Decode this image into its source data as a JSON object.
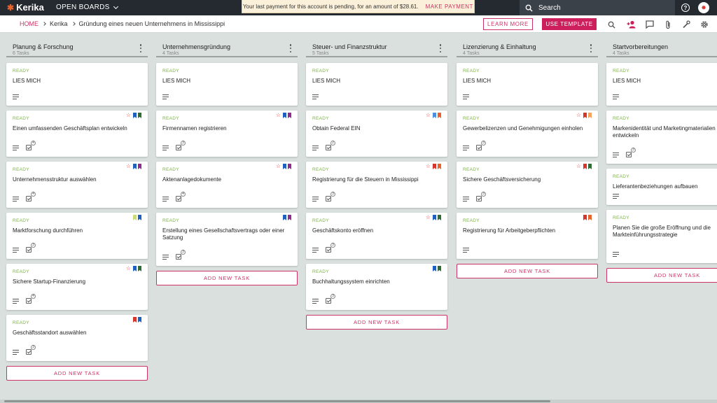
{
  "app": {
    "logo": "Kerika",
    "open_boards": "OPEN BOARDS",
    "payment_message": "Your last payment for this account is pending, for an amount of $28.61.",
    "make_payment": "MAKE PAYMENT",
    "search_placeholder": "Search"
  },
  "breadcrumb": {
    "home": "HOME",
    "org": "Kerika",
    "board": "Gründung eines neuen Unternehmens in Mississippi"
  },
  "toolbar": {
    "learn_more": "LEARN MORE",
    "use_template": "USE TEMPLATE"
  },
  "colors": {
    "accent": "#cc3366",
    "ready": "#7ab342",
    "red": "#d9342b",
    "blue": "#1f5fbf",
    "green": "#2e6b35",
    "purple": "#8e2b8f",
    "orange": "#e8622c",
    "light_blue": "#4a90e2",
    "yellow_green": "#c7dc7a",
    "light_orange": "#f5a25d"
  },
  "add_task_label": "ADD NEW TASK",
  "columns": [
    {
      "title": "Planung & Forschung",
      "count": "6 Tasks",
      "cards": [
        {
          "status": "READY",
          "title": "LIES MICH",
          "checks": null,
          "flags": [],
          "star": false
        },
        {
          "status": "READY",
          "title": "Einen umfassenden Geschäftsplan entwickeln",
          "checks": "4",
          "flags": [
            "blue",
            "green"
          ],
          "star": true
        },
        {
          "status": "READY",
          "title": "Unternehmensstruktur auswählen",
          "checks": "4",
          "flags": [
            "blue",
            "purple"
          ],
          "star": true
        },
        {
          "status": "READY",
          "title": "Marktforschung durchführen",
          "checks": "3",
          "flags": [
            "yellow_green",
            "blue"
          ],
          "star": false
        },
        {
          "status": "READY",
          "title": "Sichere Startup-Finanzierung",
          "checks": "4",
          "flags": [
            "blue",
            "green"
          ],
          "star": true
        },
        {
          "status": "READY",
          "title": "Geschäftsstandort auswählen",
          "checks": "3",
          "flags": [
            "red",
            "blue"
          ],
          "star": false
        }
      ]
    },
    {
      "title": "Unternehmensgründung",
      "count": "4 Tasks",
      "cards": [
        {
          "status": "READY",
          "title": "LIES MICH",
          "checks": null,
          "flags": [],
          "star": false
        },
        {
          "status": "READY",
          "title": "Firmennamen registrieren",
          "checks": "3",
          "flags": [
            "blue",
            "purple"
          ],
          "star": true
        },
        {
          "status": "READY",
          "title": "Aktenanlagedokumente",
          "checks": "4",
          "flags": [
            "blue",
            "purple"
          ],
          "star": true
        },
        {
          "status": "READY",
          "title": "Erstellung eines Gesellschaftsvertrags oder einer Satzung",
          "checks": "3",
          "flags": [
            "blue",
            "purple"
          ],
          "star": false
        }
      ]
    },
    {
      "title": "Steuer- und Finanzstruktur",
      "count": "5 Tasks",
      "cards": [
        {
          "status": "READY",
          "title": "LIES MICH",
          "checks": null,
          "flags": [],
          "star": false
        },
        {
          "status": "READY",
          "title": "Obtain Federal EIN",
          "checks": "2",
          "flags": [
            "light_blue",
            "orange"
          ],
          "star": true
        },
        {
          "status": "READY",
          "title": "Registrierung für die Steuern in Mississippi",
          "checks": "3",
          "flags": [
            "red",
            "orange"
          ],
          "star": true
        },
        {
          "status": "READY",
          "title": "Geschäftskonto eröffnen",
          "checks": "3",
          "flags": [
            "blue",
            "green"
          ],
          "star": true
        },
        {
          "status": "READY",
          "title": "Buchhaltungssystem einrichten",
          "checks": "3",
          "flags": [
            "blue",
            "green"
          ],
          "star": false
        }
      ]
    },
    {
      "title": "Lizenzierung & Einhaltung",
      "count": "4 Tasks",
      "cards": [
        {
          "status": "READY",
          "title": "LIES MICH",
          "checks": null,
          "flags": [],
          "star": false
        },
        {
          "status": "READY",
          "title": "Gewerbelizenzen und Genehmigungen einholen",
          "checks": "3",
          "flags": [
            "red",
            "light_orange"
          ],
          "star": true
        },
        {
          "status": "READY",
          "title": "Sichere Geschäftsversicherung",
          "checks": "3",
          "flags": [
            "red",
            "green"
          ],
          "star": true
        },
        {
          "status": "READY",
          "title": "Registrierung für Arbeitgeberpflichten",
          "checks": null,
          "flags": [
            "red",
            "orange"
          ],
          "star": false
        }
      ]
    },
    {
      "title": "Startvorbereitungen",
      "count": "4 Tasks",
      "cards": [
        {
          "status": "READY",
          "title": "LIES MICH",
          "checks": null,
          "flags": [],
          "star": false
        },
        {
          "status": "READY",
          "title": "Markenidentität und Marketingmaterialien entwickeln",
          "checks": "3",
          "flags": [],
          "star": false
        },
        {
          "status": "READY",
          "title": "Lieferantenbeziehungen aufbauen",
          "checks": null,
          "flags": [],
          "star": false
        },
        {
          "status": "READY",
          "title": "Planen Sie die große Eröffnung und die Markteinführungsstrategie",
          "checks": null,
          "flags": [],
          "star": false
        }
      ]
    }
  ]
}
